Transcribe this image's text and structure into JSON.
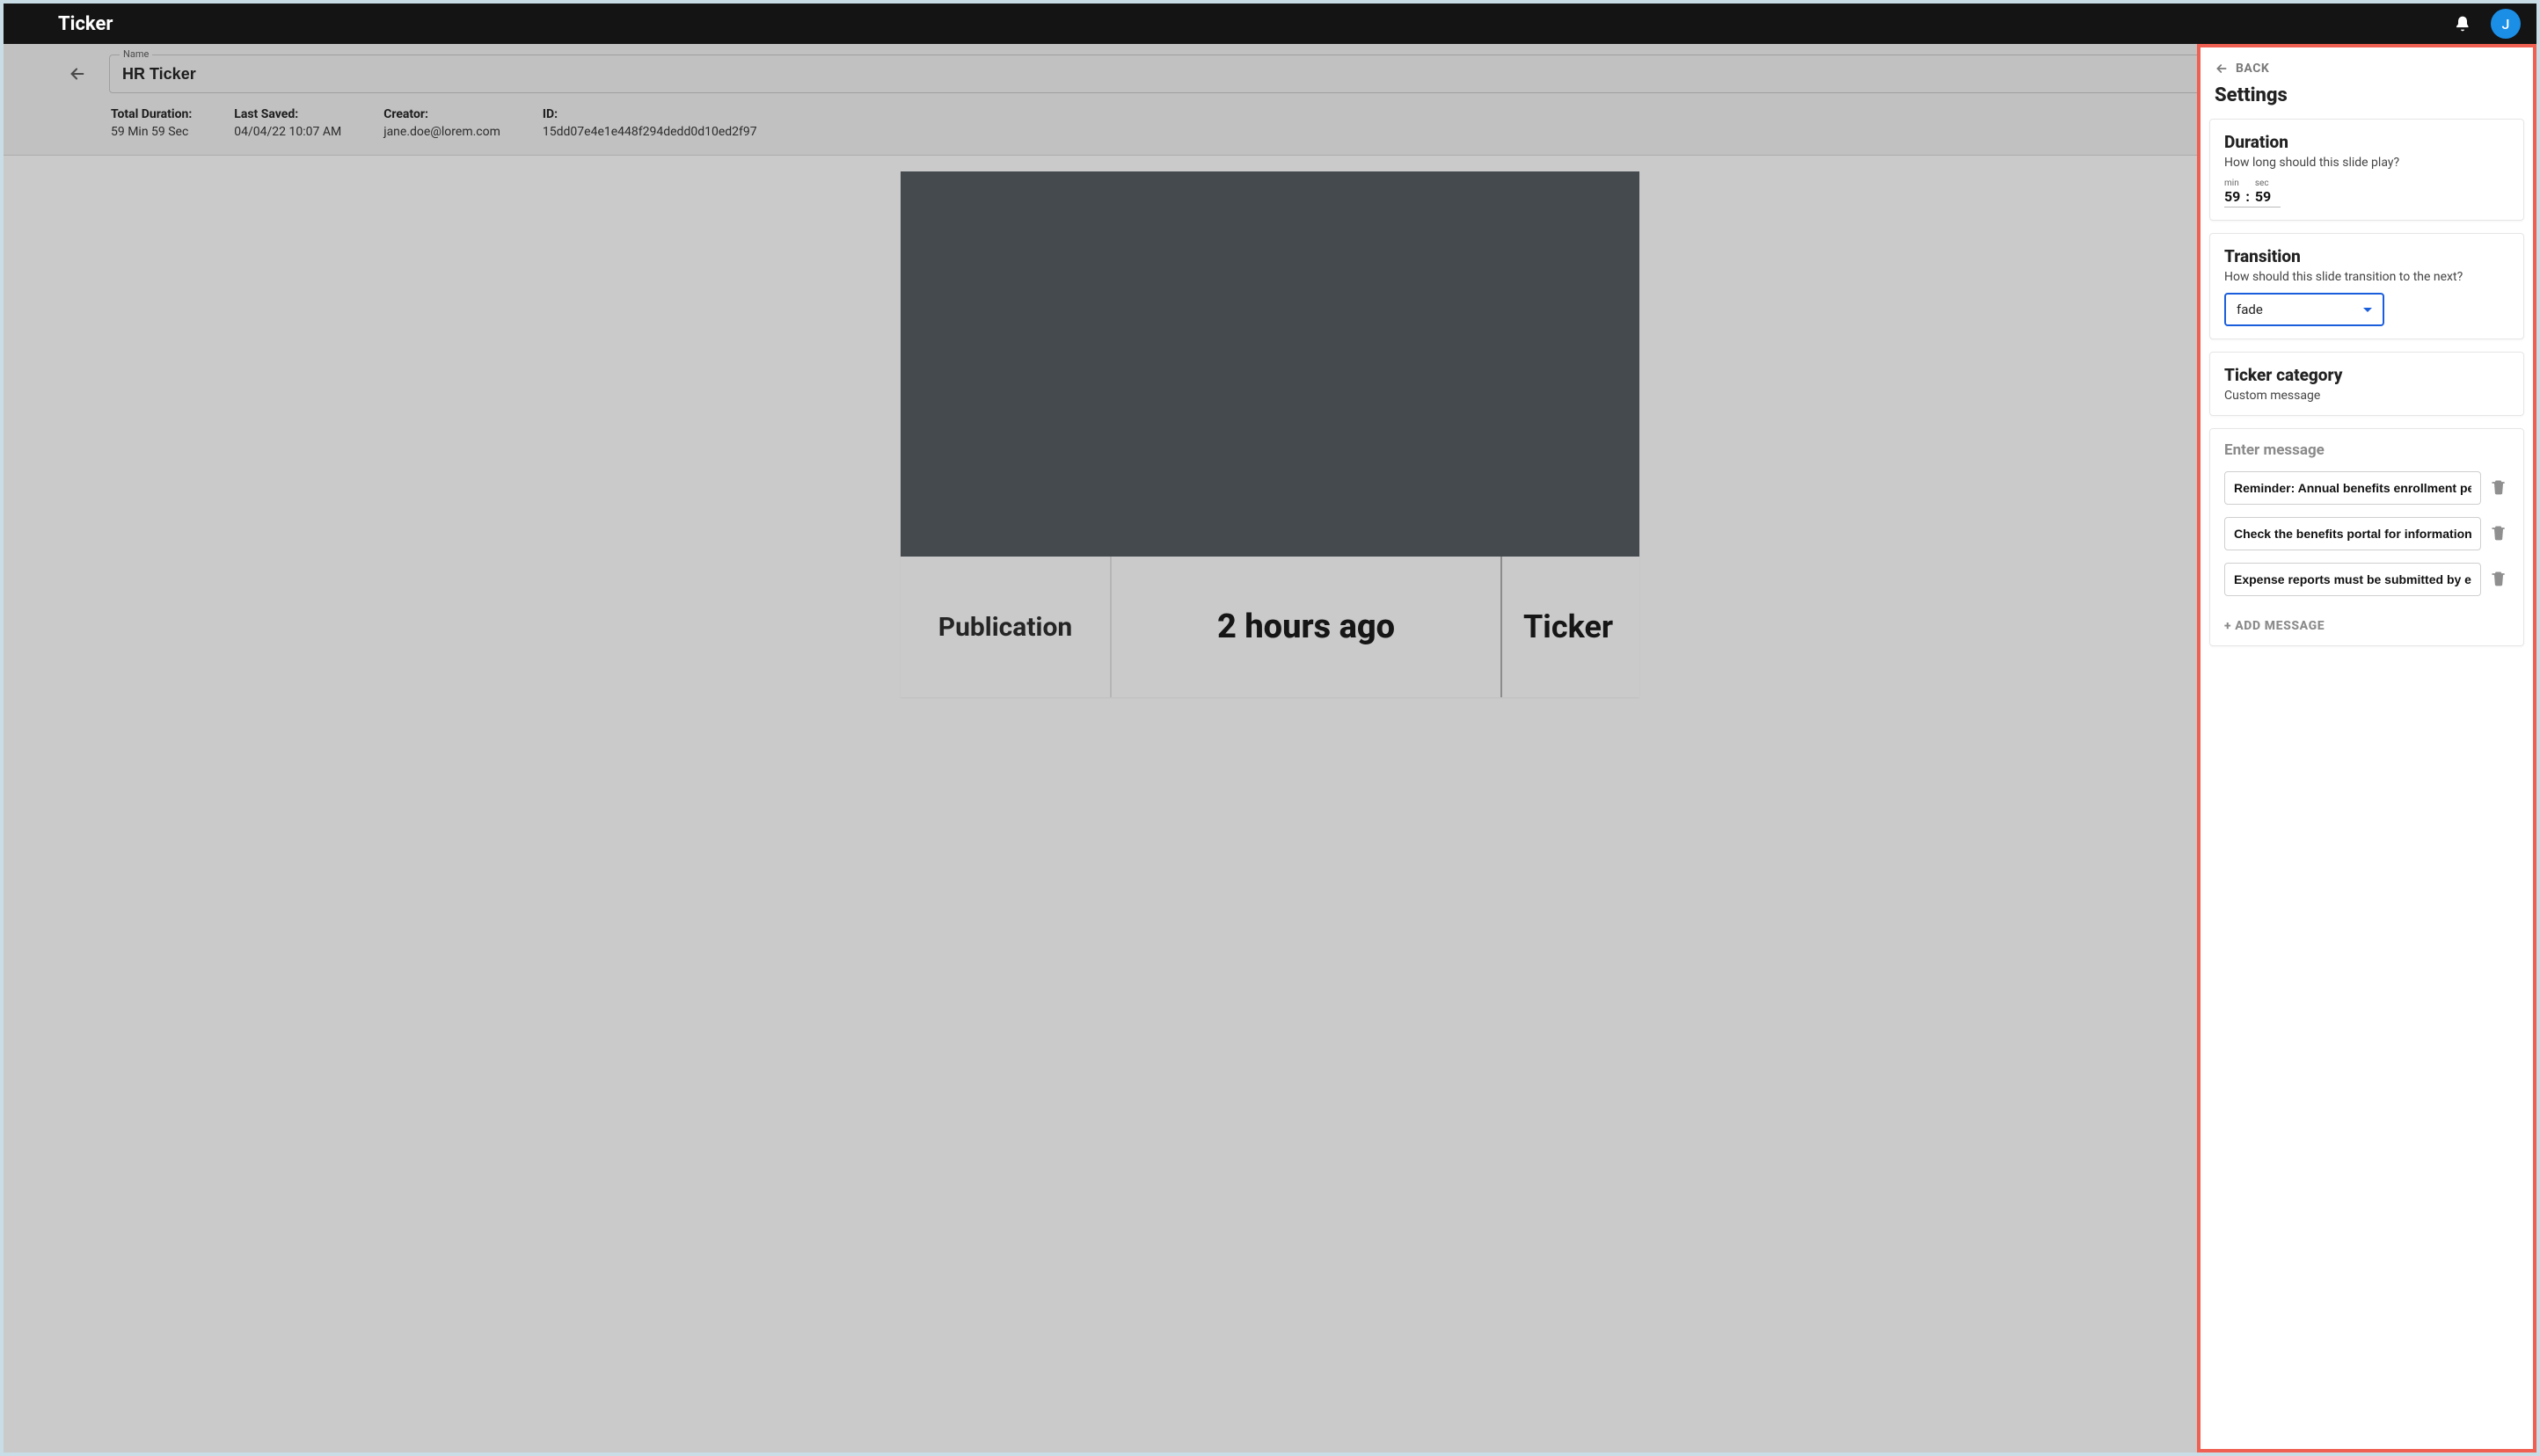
{
  "topbar": {
    "title": "Ticker",
    "avatar_initial": "J"
  },
  "header": {
    "name_label": "Name",
    "name_value": "HR Ticker",
    "meta": {
      "td_label": "Total Duration:",
      "td_value": "59 Min 59 Sec",
      "ls_label": "Last Saved:",
      "ls_value": "04/04/22 10:07 AM",
      "cr_label": "Creator:",
      "cr_value": "jane.doe@lorem.com",
      "id_label": "ID:",
      "id_value": "15dd07e4e1e448f294dedd0d10ed2f97"
    }
  },
  "ticker_preview": {
    "a": "Publication",
    "b": "2 hours ago",
    "c": "Ticker"
  },
  "panel": {
    "back": "BACK",
    "title": "Settings",
    "duration": {
      "title": "Duration",
      "sub": "How long should this slide play?",
      "min_label": "min",
      "sec_label": "sec",
      "min_value": "59",
      "sec_value": "59"
    },
    "transition": {
      "title": "Transition",
      "sub": "How should this slide transition to the next?",
      "selected": "fade"
    },
    "category": {
      "title": "Ticker category",
      "sub": "Custom message"
    },
    "messages": {
      "title": "Enter message",
      "items": [
        "Reminder: Annual benefits enrollment period ends Friday",
        "Check the benefits portal for information on updates",
        "Expense reports must be submitted by end of month"
      ],
      "add": "+ ADD MESSAGE"
    }
  }
}
